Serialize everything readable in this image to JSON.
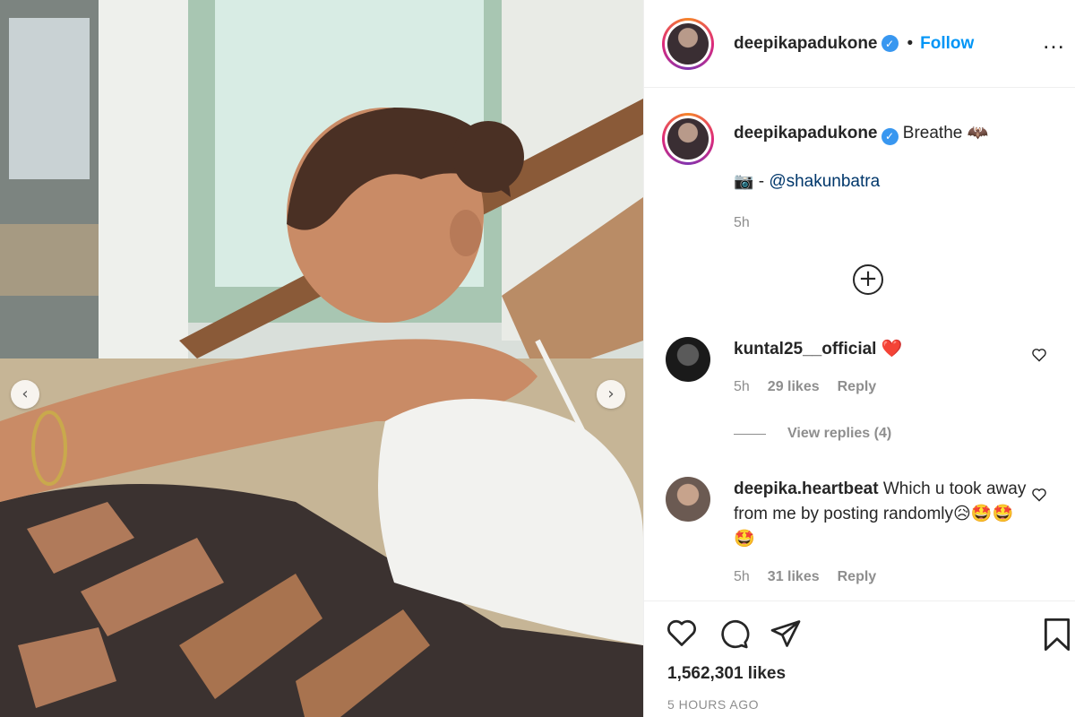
{
  "post": {
    "username": "deepikapadukone",
    "follow_label": "Follow",
    "more_label": "…"
  },
  "caption": {
    "username": "deepikapadukone",
    "text": "Breathe",
    "emoji": "🦇",
    "credit_prefix": "- ",
    "credit_mention": "@shakunbatra",
    "timestamp": "5h"
  },
  "comments": [
    {
      "username": "kuntal25__official",
      "text": "❤️",
      "time": "5h",
      "likes": "29 likes",
      "reply": "Reply"
    },
    {
      "username": "deepika.heartbeat",
      "text": "Which u took away from me by posting randomly😥🤩🤩🤩",
      "time": "5h",
      "likes": "31 likes",
      "reply": "Reply"
    }
  ],
  "view_replies": "View replies (4)",
  "likes_count": "1,562,301 likes",
  "posted_ago": "5 HOURS AGO",
  "icons": {
    "verified": "verified-badge-icon",
    "load_more": "plus-circle-icon",
    "like": "heart-icon",
    "comment": "comment-bubble-icon",
    "share": "paper-plane-icon",
    "save": "bookmark-icon",
    "prev": "chevron-left-icon",
    "next": "chevron-right-icon"
  },
  "colors": {
    "accent": "#0095f6",
    "verified": "#3897f0",
    "muted": "#8e8e8e",
    "heart": "#ed4956"
  }
}
